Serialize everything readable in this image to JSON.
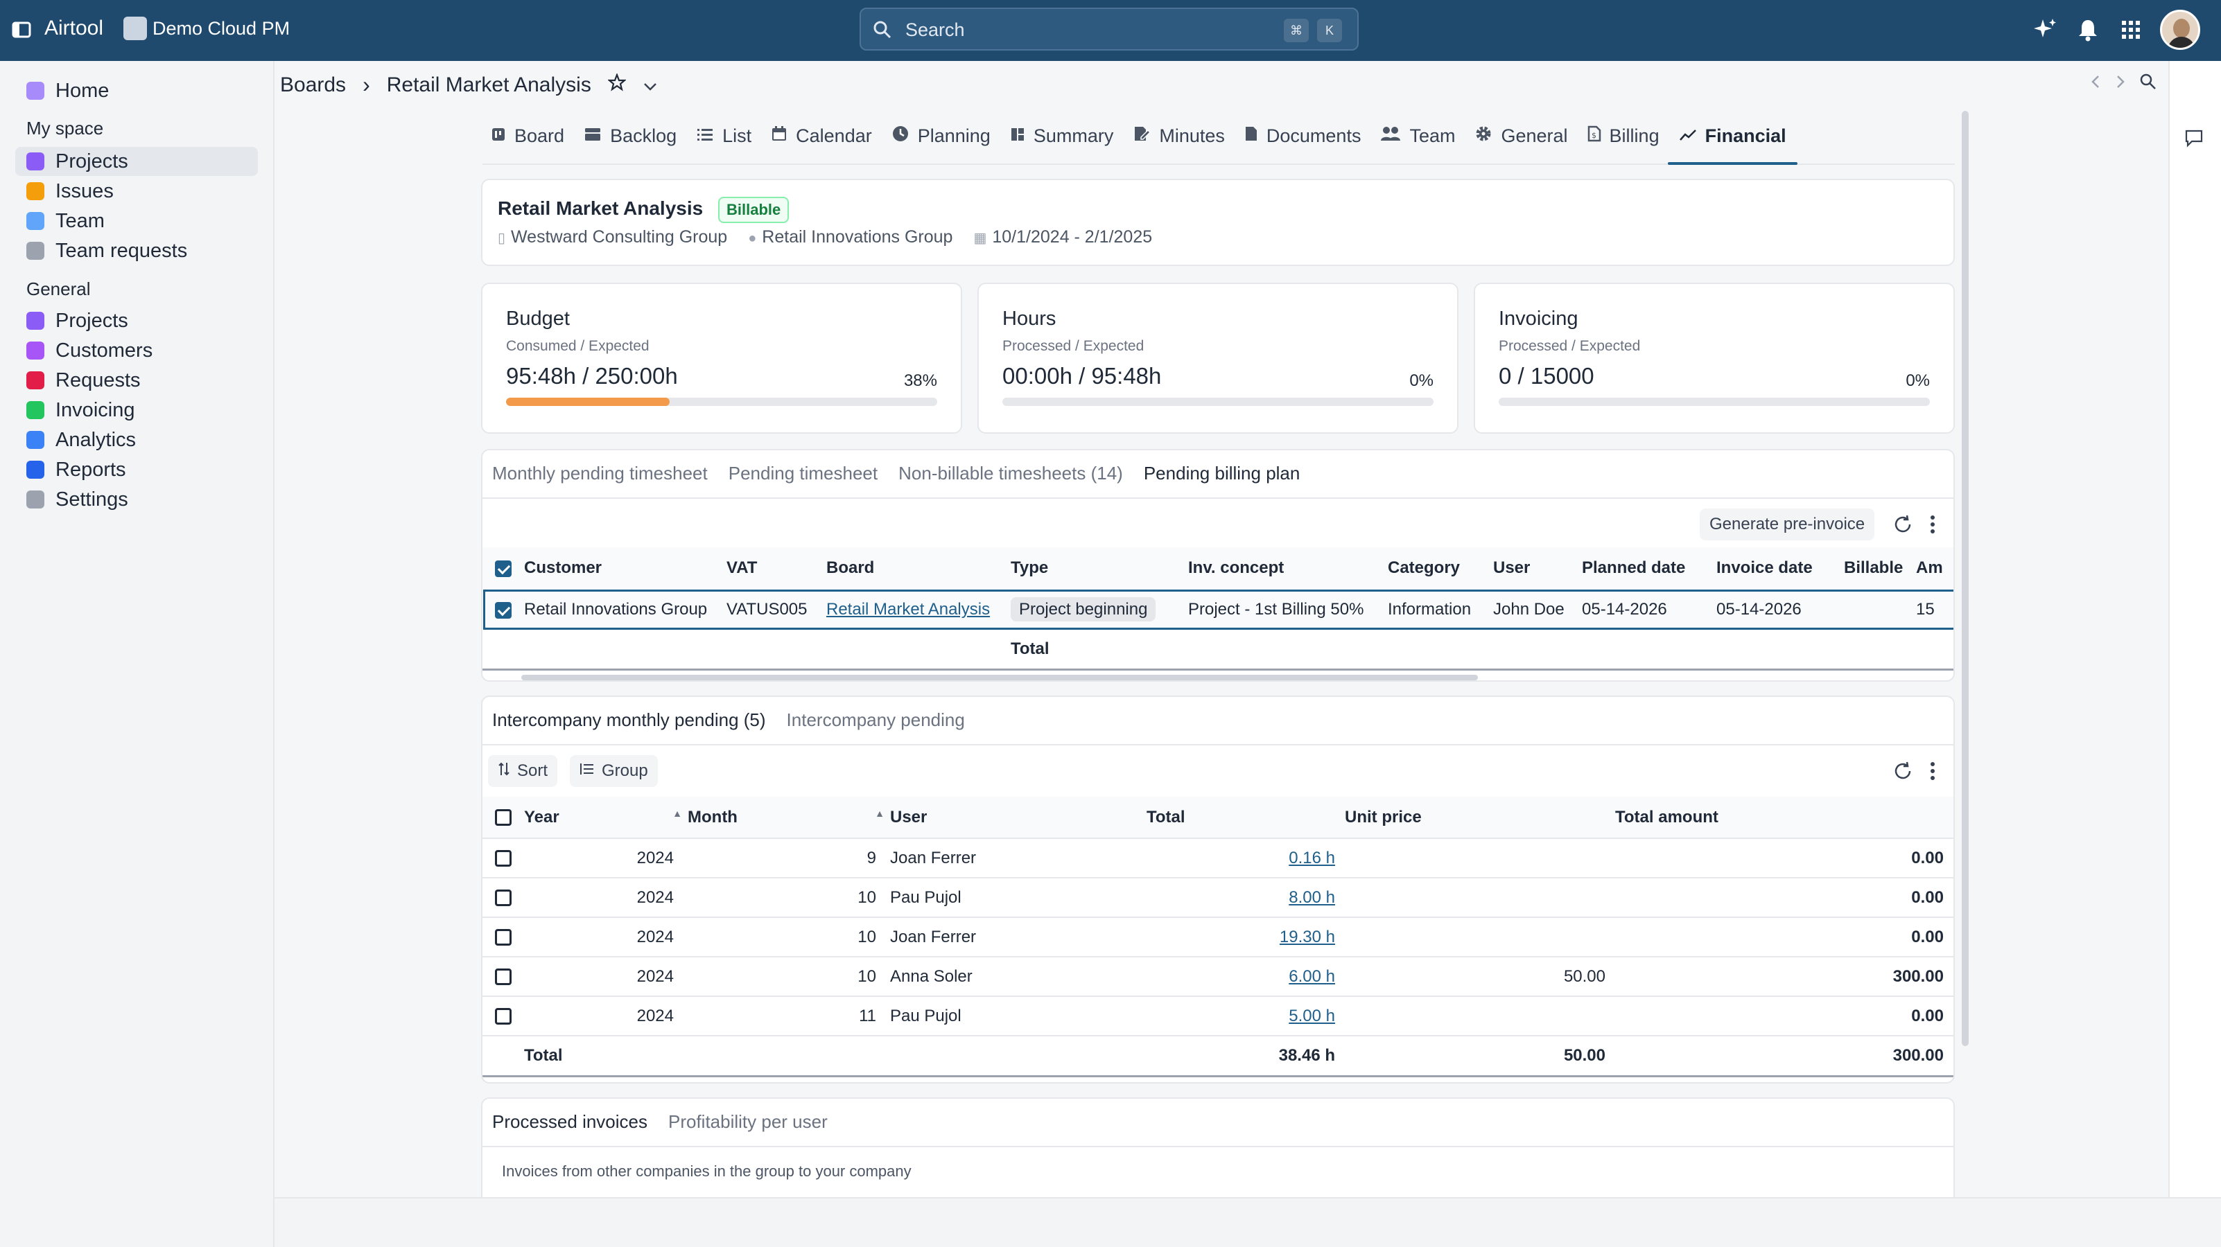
{
  "app": {
    "name": "Airtool",
    "workspace": "Demo Cloud PM"
  },
  "search": {
    "placeholder": "Search",
    "kbd1": "⌘",
    "kbd2": "K"
  },
  "sidebar": {
    "home": "Home",
    "my_space_title": "My space",
    "my_space": [
      "Projects",
      "Issues",
      "Team",
      "Team requests"
    ],
    "general_title": "General",
    "general": [
      "Projects",
      "Customers",
      "Requests",
      "Invoicing",
      "Analytics",
      "Reports",
      "Settings"
    ]
  },
  "breadcrumb": {
    "root": "Boards",
    "sep": "›",
    "current": "Retail Market Analysis"
  },
  "tabs": [
    "Board",
    "Backlog",
    "List",
    "Calendar",
    "Planning",
    "Summary",
    "Minutes",
    "Documents",
    "Team",
    "General",
    "Billing",
    "Financial"
  ],
  "project": {
    "title": "Retail Market Analysis",
    "badge": "Billable",
    "company": "Westward Consulting Group",
    "customer": "Retail Innovations Group",
    "dates": "10/1/2024 - 2/1/2025"
  },
  "kpis": {
    "budget": {
      "title": "Budget",
      "sub": "Consumed / Expected",
      "value": "95:48h / 250:00h",
      "pct": "38%",
      "fill": 0.38
    },
    "hours": {
      "title": "Hours",
      "sub": "Processed / Expected",
      "value": "00:00h / 95:48h",
      "pct": "0%",
      "fill": 0
    },
    "invoicing": {
      "title": "Invoicing",
      "sub": "Processed / Expected",
      "value": "0 / 15000",
      "pct": "0%",
      "fill": 0
    }
  },
  "pending": {
    "tabs": [
      "Monthly pending timesheet",
      "Pending timesheet",
      "Non-billable timesheets (14)",
      "Pending billing plan"
    ],
    "generate": "Generate pre-invoice",
    "headers": [
      "Customer",
      "VAT",
      "Board",
      "Type",
      "Inv. concept",
      "Category",
      "User",
      "Planned date",
      "Invoice date",
      "Billable",
      "Am"
    ],
    "row": {
      "customer": "Retail Innovations Group",
      "vat": "VATUS005",
      "board": "Retail Market Analysis",
      "type": "Project beginning",
      "concept": "Project - 1st Billing 50%",
      "category": "Information",
      "user": "John Doe",
      "planned": "05-14-2026",
      "invoice": "05-14-2026",
      "billable": "",
      "amount": "15"
    },
    "total_label": "Total"
  },
  "intercompany": {
    "tabs": [
      "Intercompany monthly pending (5)",
      "Intercompany pending"
    ],
    "sort": "Sort",
    "group": "Group",
    "headers": [
      "Year",
      "Month",
      "User",
      "Total",
      "Unit price",
      "Total amount"
    ],
    "rows": [
      {
        "year": "2024",
        "month": "9",
        "user": "Joan Ferrer",
        "total": "0.16 h",
        "unit": "",
        "amount": "0.00"
      },
      {
        "year": "2024",
        "month": "10",
        "user": "Pau Pujol",
        "total": "8.00 h",
        "unit": "",
        "amount": "0.00"
      },
      {
        "year": "2024",
        "month": "10",
        "user": "Joan Ferrer",
        "total": "19.30 h",
        "unit": "",
        "amount": "0.00"
      },
      {
        "year": "2024",
        "month": "10",
        "user": "Anna Soler",
        "total": "6.00 h",
        "unit": "50.00",
        "amount": "300.00"
      },
      {
        "year": "2024",
        "month": "11",
        "user": "Pau Pujol",
        "total": "5.00 h",
        "unit": "",
        "amount": "0.00"
      }
    ],
    "totals": {
      "label": "Total",
      "total": "38.46 h",
      "unit": "50.00",
      "amount": "300.00"
    }
  },
  "processed": {
    "tabs": [
      "Processed invoices",
      "Profitability per user"
    ],
    "note": "Invoices from other companies in the group to your company"
  }
}
